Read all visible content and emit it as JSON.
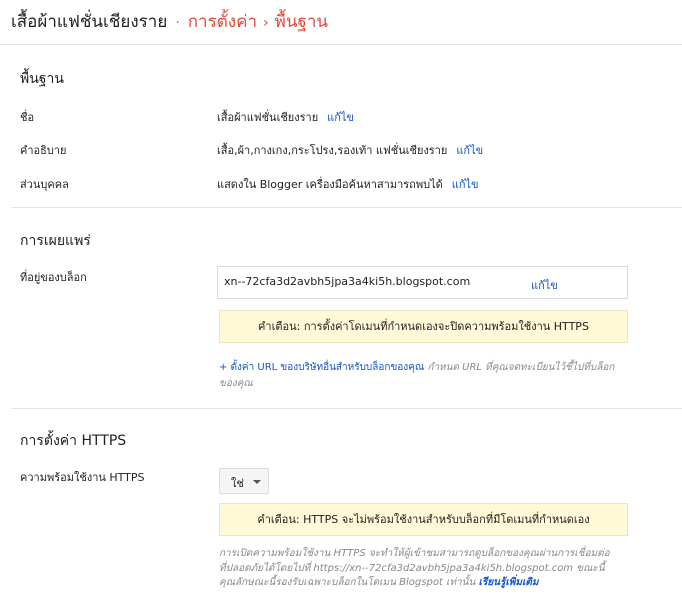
{
  "header": {
    "blog_name": "เสื้อผ้าแฟชั่นเชียงราย",
    "separator": "·",
    "settings_link": "การตั้งค่า",
    "arrow": "›",
    "current_page": "พื้นฐาน"
  },
  "basics": {
    "title": "พื้นฐาน",
    "title_row": {
      "label": "ชื่อ",
      "value": "เสื้อผ้าแฟชั่นเชียงราย",
      "edit": "แก้ไข"
    },
    "description_row": {
      "label": "คำอธิบาย",
      "value": "เสื้อ,ผ้า,กางเกง,กระโปรง,รองเท้า แฟชั่นเชียงราย",
      "edit": "แก้ไข"
    },
    "privacy_row": {
      "label": "ส่วนบุคคล",
      "value": "แสดงใน Blogger เครื่องมือค้นหาสามารถพบได้",
      "edit": "แก้ไข"
    }
  },
  "publishing": {
    "title": "การเผยแพร่",
    "address_label": "ที่อยู่ของบล็อก",
    "address_value": "xn--72cfa3d2avbh5jpa3a4ki5h.blogspot.com",
    "address_edit": "แก้ไข",
    "warning": "คำเตือน: การตั้งค่าโดเมนที่กำหนดเองจะปิดความพร้อมใช้งาน HTTPS",
    "custom_url_link": "+ ตั้งค่า URL ของบริษัทอื่นสำหรับบล็อกของคุณ",
    "custom_url_desc": "กำหนด URL ที่คุณจดทะเบียนไว้ชี้ไปที่บล็อกของคุณ"
  },
  "https": {
    "title": "การตั้งค่า HTTPS",
    "availability_label": "ความพร้อมใช้งาน HTTPS",
    "availability_value": "ใช่",
    "warning": "คำเตือน: HTTPS จะไม่พร้อมใช้งานสำหรับบล็อกที่มีโดเมนที่กำหนดเอง",
    "note_line1": "การเปิดความพร้อมใช้งาน HTTPS จะทำให้ผู้เข้าชมสามารถดูบล็อกของคุณผ่านการเชื่อมต่อ",
    "note_line2": "ที่ปลอดภัยได้โดยไปที่ https://xn--72cfa3d2avbh5jpa3a4ki5h.blogspot.com ขณะนี้",
    "note_line3": "คุณลักษณะนี้รองรับเฉพาะบล็อกในโดเมน Blogspot เท่านั้น",
    "learn_more": "เรียนรู้เพิ่มเติม"
  }
}
